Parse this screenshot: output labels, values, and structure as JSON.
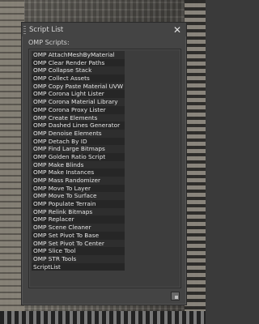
{
  "window": {
    "title": "Script List",
    "close_label": "✕"
  },
  "section_label": "OMP Scripts:",
  "scripts": [
    "OMP AttachMeshByMaterial",
    "OMP Clear Render Paths",
    "OMP Collapse Stack",
    "OMP Collect Assets",
    "OMP Copy Paste Material UVW",
    "OMP Corona Light Lister",
    "OMP Corona Material Library",
    "OMP Corona Proxy Lister",
    "OMP Create Elements",
    "OMP Dashed Lines Generator",
    "OMP Denoise Elements",
    "OMP Detach By ID",
    "OMP Find Large Bitmaps",
    "OMP Golden Ratio Script",
    "OMP Make Blinds",
    "OMP Make Instances",
    "OMP Mass Randomizer",
    "OMP Move To Layer",
    "OMP Move To Surface",
    "OMP Populate Terrain",
    "OMP Relink Bitmaps",
    "OMP Replacer",
    "OMP Scene Cleaner",
    "OMP Set Pivot To Base",
    "OMP Set Pivot To Center",
    "OMP Slice Tool",
    "OMP STR Tools",
    "ScriptList"
  ],
  "icons": {
    "close": "close-icon",
    "grip": "drag-grip-icon",
    "resize": "resize-grip-icon"
  }
}
